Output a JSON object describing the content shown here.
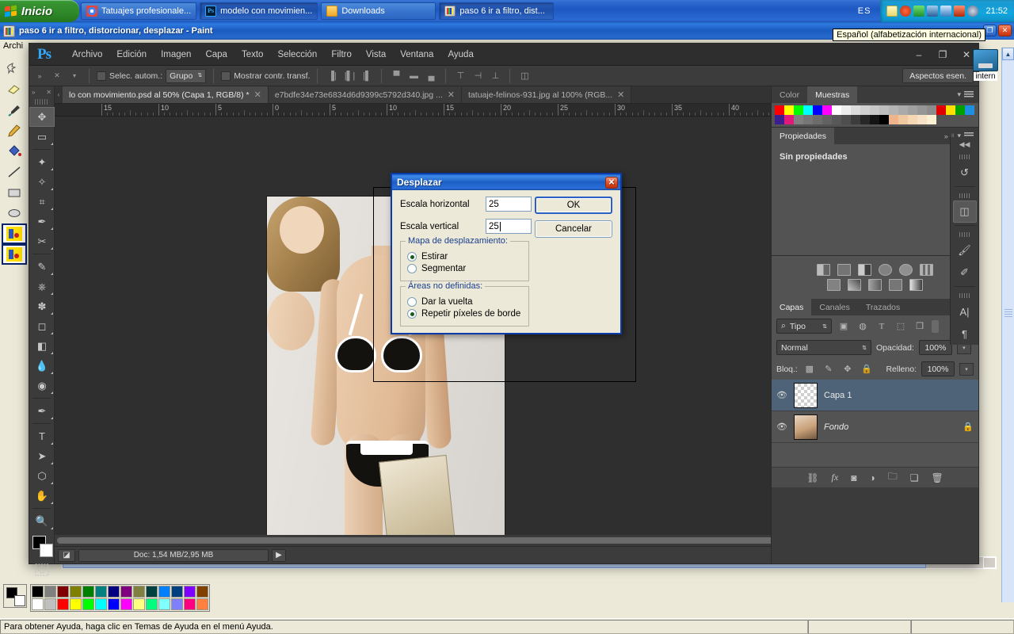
{
  "taskbar": {
    "start_label": "Inicio",
    "buttons": [
      {
        "label": "Tatuajes profesionale...",
        "icon": "chrome-icon",
        "active": false
      },
      {
        "label": "modelo con movimien...",
        "icon": "photoshop-icon",
        "active": true
      },
      {
        "label": "Downloads",
        "icon": "folder-icon",
        "active": false
      },
      {
        "label": "paso 6 ir a filtro, dist...",
        "icon": "paint-icon",
        "active": true
      }
    ],
    "language_indicator": "ES",
    "clock": "21:52",
    "tray_icons": [
      "note-icon",
      "antivirus-icon",
      "shield-icon",
      "display-icon",
      "network-icon",
      "volume-icon",
      "update-icon"
    ]
  },
  "tooltip": {
    "text": "Español (alfabetización internacional)"
  },
  "paint_window": {
    "title": "paso 6 ir a filtro, distorcionar, desplazar - Paint",
    "menu_first": "Archi",
    "status_help": "Para obtener Ayuda, haga clic en Temas de Ayuda en el menú Ayuda.",
    "window_controls": {
      "restore": "❐",
      "close": "✕"
    },
    "palette_row1": [
      "#000000",
      "#808080",
      "#800000",
      "#808000",
      "#008000",
      "#008080",
      "#000080",
      "#800080",
      "#808040",
      "#004040",
      "#0080ff",
      "#004080",
      "#8000ff",
      "#804000"
    ],
    "palette_row2": [
      "#ffffff",
      "#c0c0c0",
      "#ff0000",
      "#ffff00",
      "#00ff00",
      "#00ffff",
      "#0000ff",
      "#ff00ff",
      "#ffff80",
      "#00ff80",
      "#80ffff",
      "#8080ff",
      "#ff0080",
      "#ff8040"
    ]
  },
  "photoshop": {
    "logo": "Ps",
    "menus": [
      "Archivo",
      "Edición",
      "Imagen",
      "Capa",
      "Texto",
      "Selección",
      "Filtro",
      "Vista",
      "Ventana",
      "Ayuda"
    ],
    "window_controls": {
      "minimize": "–",
      "maximize": "❐",
      "close": "✕"
    },
    "options_bar": {
      "auto_select_label": "Selec. autom.:",
      "auto_select_value": "Grupo",
      "show_transform_label": "Mostrar contr. transf.",
      "workspace": "Aspectos esen."
    },
    "tabs": [
      {
        "label": "lo con movimiento.psd al 50% (Capa 1, RGB/8) *",
        "active": true
      },
      {
        "label": "e7bdfe34e73e6834d6d9399c5792d340.jpg ...",
        "active": false
      },
      {
        "label": "tatuaje-felinos-931.jpg al 100% (RGB...",
        "active": false
      }
    ],
    "ruler_labels": [
      "15",
      "10",
      "5",
      "0",
      "5",
      "10",
      "15",
      "20",
      "25",
      "30",
      "35",
      "40"
    ],
    "status": {
      "doc_info": "Doc: 1,54 MB/2,95 MB",
      "arrow": "▶"
    },
    "tools": [
      {
        "name": "move-tool",
        "glyph": "✥",
        "selected": true
      },
      {
        "name": "rectangular-marquee-tool",
        "glyph": "▭",
        "selected": false
      },
      {
        "name": "lasso-tool",
        "glyph": "✦",
        "selected": false
      },
      {
        "name": "quick-selection-tool",
        "glyph": "✧",
        "selected": false
      },
      {
        "name": "crop-tool",
        "glyph": "⌗",
        "selected": false
      },
      {
        "name": "eyedropper-tool",
        "glyph": "✒",
        "selected": false
      },
      {
        "name": "healing-brush-tool",
        "glyph": "✂",
        "selected": false
      },
      {
        "name": "brush-tool",
        "glyph": "✎",
        "selected": false
      },
      {
        "name": "clone-stamp-tool",
        "glyph": "⎈",
        "selected": false
      },
      {
        "name": "history-brush-tool",
        "glyph": "✽",
        "selected": false
      },
      {
        "name": "eraser-tool",
        "glyph": "◻",
        "selected": false
      },
      {
        "name": "gradient-tool",
        "glyph": "◧",
        "selected": false
      },
      {
        "name": "blur-tool",
        "glyph": "💧",
        "selected": false
      },
      {
        "name": "dodge-tool",
        "glyph": "◉",
        "selected": false
      },
      {
        "name": "pen-tool",
        "glyph": "✒",
        "selected": false
      },
      {
        "name": "type-tool",
        "glyph": "T",
        "selected": false
      },
      {
        "name": "path-selection-tool",
        "glyph": "➤",
        "selected": false
      },
      {
        "name": "shape-tool",
        "glyph": "⬡",
        "selected": false
      },
      {
        "name": "hand-tool",
        "glyph": "✋",
        "selected": false
      },
      {
        "name": "zoom-tool",
        "glyph": "🔍",
        "selected": false
      }
    ],
    "foreground_color": "#000000",
    "background_color": "#ffffff",
    "panels": {
      "color_swatches": {
        "tabs": [
          {
            "label": "Color",
            "active": false
          },
          {
            "label": "Muestras",
            "active": true
          }
        ],
        "row1": [
          "#ff0000",
          "#ffff00",
          "#00ff00",
          "#00ffff",
          "#0000ff",
          "#ff00ff",
          "#ffffff",
          "#ededed",
          "#dcdcdc",
          "#d2d2d2",
          "#c8c8c8",
          "#bebebe",
          "#b4b4b4",
          "#aaaaaa",
          "#a0a0a0",
          "#969696",
          "#8c8c8c",
          "#e00000",
          "#ffe000"
        ],
        "row2": [
          "#00a000",
          "#1e90e0",
          "#3c1e8c",
          "#e0197d",
          "#808080",
          "#767676",
          "#6c6c6c",
          "#626262",
          "#585858",
          "#4e4e4e",
          "#3c3c3c",
          "#282828",
          "#141414",
          "#000000",
          "#f0b48c",
          "#f0c8a0",
          "#f5d7b4",
          "#f7e2c8",
          "#fbf0d2"
        ]
      },
      "properties": {
        "tab": "Propiedades",
        "empty_text": "Sin propiedades",
        "collapse_icon": "double-chevron-right-icon"
      },
      "adjustments_row1": [
        "brightness-icon",
        "levels-icon",
        "curves-icon",
        "exposure-icon",
        "vibrance-icon",
        "hue-saturation-icon"
      ],
      "adjustments_row2": [
        "color-balance-icon",
        "black-white-icon",
        "photo-filter-icon",
        "channel-mixer-icon",
        "gradient-map-icon"
      ],
      "layers": {
        "tabs": [
          {
            "label": "Capas",
            "active": true
          },
          {
            "label": "Canales",
            "active": false
          },
          {
            "label": "Trazados",
            "active": false
          }
        ],
        "filter_label": "Tipo",
        "blend_mode": "Normal",
        "opacity_label": "Opacidad:",
        "opacity_value": "100%",
        "lock_label": "Bloq.:",
        "fill_label": "Relleno:",
        "fill_value": "100%",
        "items": [
          {
            "name": "Capa 1",
            "selected": true,
            "locked": false,
            "thumb": "transparent",
            "visible": true
          },
          {
            "name": "Fondo",
            "selected": false,
            "locked": true,
            "thumb": "photo",
            "visible": true
          }
        ],
        "footer_icons": [
          "link-icon",
          "fx-icon",
          "mask-icon",
          "adjustment-icon",
          "group-icon",
          "new-layer-icon",
          "delete-icon"
        ]
      }
    },
    "icon_rail": [
      {
        "name": "history-icon",
        "glyph": "↺",
        "selected": false
      },
      {
        "name": "3d-icon",
        "glyph": "◫",
        "selected": true
      },
      {
        "name": "brush-presets-icon",
        "glyph": "🖌",
        "selected": false
      },
      {
        "name": "brush-icon",
        "glyph": "✏",
        "selected": false
      },
      {
        "name": "character-icon",
        "glyph": "A",
        "selected": false
      },
      {
        "name": "paragraph-icon",
        "glyph": "¶",
        "selected": false
      }
    ]
  },
  "dialog": {
    "title": "Desplazar",
    "close_glyph": "✕",
    "fields": [
      {
        "label": "Escala horizontal",
        "value": "25",
        "focused": false
      },
      {
        "label": "Escala vertical",
        "value": "25",
        "focused": true
      }
    ],
    "groups": [
      {
        "legend": "Mapa de desplazamiento:",
        "options": [
          {
            "label": "Estirar",
            "checked": true
          },
          {
            "label": "Segmentar",
            "checked": false
          }
        ]
      },
      {
        "legend": "Áreas no definidas:",
        "options": [
          {
            "label": "Dar la vuelta",
            "checked": false
          },
          {
            "label": "Repetir píxeles de borde",
            "checked": true
          }
        ]
      }
    ],
    "buttons": {
      "ok": "OK",
      "cancel": "Cancelar"
    }
  },
  "desktop": {
    "icon_label": "intern"
  }
}
